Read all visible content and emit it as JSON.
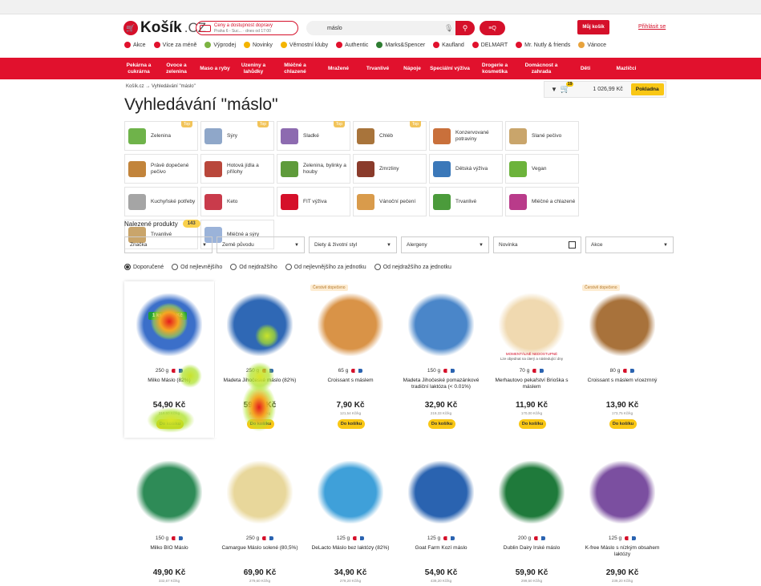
{
  "header": {
    "logo_text": "Košík",
    "logo_tld": ".CZ",
    "delivery_line1": "Ceny a dostupnost dopravy",
    "delivery_line2": "Praha 6 - Suc... · dnes od 17:00",
    "search_value": "máslo",
    "filter_label": "≡Q",
    "cart_label": "Můj košík",
    "login_label": "Přihlásit se"
  },
  "shortcuts": [
    {
      "label": "Akce",
      "color": "#e1112d"
    },
    {
      "label": "Více za méně",
      "color": "#e1112d"
    },
    {
      "label": "Výprodej",
      "color": "#7cb342"
    },
    {
      "label": "Novinky",
      "color": "#f4b400"
    },
    {
      "label": "Věrnostní kluby",
      "color": "#f4b400"
    },
    {
      "label": "Authentic",
      "color": "#e1112d"
    },
    {
      "label": "Marks&Spencer",
      "color": "#2e7d32"
    },
    {
      "label": "Kaufland",
      "color": "#e1112d"
    },
    {
      "label": "DELMART",
      "color": "#e1112d"
    },
    {
      "label": "Mr. Nutly & friends",
      "color": "#e1112d"
    },
    {
      "label": "Vánoce",
      "color": "#e8a33d"
    }
  ],
  "shortcut_marks": {
    "mas": "M&S",
    "delmart": "D"
  },
  "nav": [
    "Pekárna a cukrárna",
    "Ovoce a zelenina",
    "Maso a ryby",
    "Uzeniny a lahůdky",
    "Mléčné a chlazené",
    "Mražené",
    "Trvanlivé",
    "Nápoje",
    "Speciální výživa",
    "Drogerie a kosmetika",
    "Domácnost a zahrada",
    "Děti",
    "Mazlíčci"
  ],
  "breadcrumb": "Košík.cz → Vyhledávání \"máslo\"",
  "cartbar": {
    "badge": "19",
    "sum": "1 026,99 Kč",
    "checkout": "Pokladna"
  },
  "page_title": "Vyhledávání \"máslo\"",
  "categories": [
    {
      "label": "Zelenina",
      "top": true,
      "color": "#6fb34a"
    },
    {
      "label": "Sýry",
      "top": true,
      "color": "#8fa7c9"
    },
    {
      "label": "Sladké",
      "top": true,
      "color": "#8d6bb0"
    },
    {
      "label": "Chléb",
      "top": true,
      "color": "#a8743b"
    },
    {
      "label": "Konzervované potraviny",
      "top": false,
      "color": "#c9703b"
    },
    {
      "label": "Slané pečivo",
      "top": false,
      "color": "#c9a56b"
    },
    {
      "label": "Právě dopečené pečivo",
      "top": false,
      "color": "#c2843b"
    },
    {
      "label": "Hotová jídla a přílohy",
      "top": false,
      "color": "#b9473b"
    },
    {
      "label": "Zelenina, bylinky a houby",
      "top": false,
      "color": "#5f9b3b"
    },
    {
      "label": "Zmrzliny",
      "top": false,
      "color": "#8a3b2b"
    },
    {
      "label": "Dětská výživa",
      "top": false,
      "color": "#3b78b9"
    },
    {
      "label": "Vegan",
      "top": false,
      "color": "#6cb33b"
    },
    {
      "label": "Kuchyňské potřeby",
      "top": false,
      "color": "#a5a5a5"
    },
    {
      "label": "Keto",
      "top": false,
      "color": "#c93b4b"
    },
    {
      "label": "FIT výživa",
      "top": false,
      "color": "#d5102a"
    },
    {
      "label": "Vánoční pečení",
      "top": false,
      "color": "#d99b4b"
    },
    {
      "label": "Trvanlivé",
      "top": false,
      "color": "#4b9b3b"
    },
    {
      "label": "Mléčné a chlazené",
      "top": false,
      "color": "#b93b8a"
    },
    {
      "label": "Trvanlivé",
      "top": false,
      "color": "#c9a56b"
    },
    {
      "label": "Mléčné a sýry",
      "top": false,
      "color": "#9bb3d9"
    }
  ],
  "category_top_label": "Top",
  "found": {
    "label": "Nalezené produkty",
    "count": "143"
  },
  "filters": [
    {
      "label": "Značka",
      "kind": "select"
    },
    {
      "label": "Země původu",
      "kind": "select"
    },
    {
      "label": "Diety & životní styl",
      "kind": "select"
    },
    {
      "label": "Alergeny",
      "kind": "select"
    },
    {
      "label": "Novinka",
      "kind": "checkbox"
    },
    {
      "label": "Akce",
      "kind": "select"
    }
  ],
  "sorts": [
    {
      "label": "Doporučené",
      "selected": true
    },
    {
      "label": "Od nejlevnějšího",
      "selected": false
    },
    {
      "label": "Od nejdražšího",
      "selected": false
    },
    {
      "label": "Od nejlevnějšího za jednotku",
      "selected": false
    },
    {
      "label": "Od nejdražšího za jednotku",
      "selected": false
    }
  ],
  "products": [
    {
      "name": "Milko Máslo (82%)",
      "weight": "250 g",
      "price": "54,90 Kč",
      "unit": "219,60 Kč/kg",
      "fresh": false,
      "badge": "1 ks 54,90 Kč",
      "color": "#3b6fc9",
      "oos": false
    },
    {
      "name": "Madeta Jihočeské máslo (82%)",
      "weight": "250 g",
      "price": "59,90 Kč",
      "unit": "239,60 Kč/kg",
      "fresh": false,
      "badge": "",
      "color": "#2f68b5",
      "oos": false
    },
    {
      "name": "Croissant s máslem",
      "weight": "65 g",
      "price": "7,90 Kč",
      "unit": "121,54 Kč/kg",
      "fresh": true,
      "badge": "",
      "color": "#d99347",
      "oos": false
    },
    {
      "name": "Madeta Jihočeské pomazánkové tradiční laktóza (< 0.01%)",
      "weight": "150 g",
      "price": "32,90 Kč",
      "unit": "219,33 Kč/kg",
      "fresh": false,
      "badge": "",
      "color": "#4a86c9",
      "oos": false
    },
    {
      "name": "Merhautovo pekařství Brioška s máslem",
      "weight": "70 g",
      "price": "11,90 Kč",
      "unit": "170,00 Kč/kg",
      "fresh": false,
      "badge": "",
      "color": "#f0d9b0",
      "oos": true
    },
    {
      "name": "Croissant s máslem vícezrnný",
      "weight": "80 g",
      "price": "13,90 Kč",
      "unit": "173,75 Kč/kg",
      "fresh": true,
      "badge": "",
      "color": "#a8723b",
      "oos": false
    },
    {
      "name": "Milko BIO Máslo",
      "weight": "150 g",
      "price": "49,90 Kč",
      "unit": "332,67 Kč/kg",
      "fresh": false,
      "badge": "",
      "color": "#2e8b57",
      "oos": false
    },
    {
      "name": "Camargue Máslo solené (80,5%)",
      "weight": "250 g",
      "price": "69,90 Kč",
      "unit": "279,60 Kč/kg",
      "fresh": false,
      "badge": "",
      "color": "#e8d79b",
      "oos": false
    },
    {
      "name": "DeLacto Máslo bez laktózy (82%)",
      "weight": "125 g",
      "price": "34,90 Kč",
      "unit": "279,20 Kč/kg",
      "fresh": false,
      "badge": "",
      "color": "#3fa0d9",
      "oos": false
    },
    {
      "name": "Goat Farm Kozí máslo",
      "weight": "125 g",
      "price": "54,90 Kč",
      "unit": "439,20 Kč/kg",
      "fresh": false,
      "badge": "",
      "color": "#2a63b0",
      "oos": false
    },
    {
      "name": "Dublin Dairy Irské máslo",
      "weight": "200 g",
      "price": "59,90 Kč",
      "unit": "299,50 Kč/kg",
      "fresh": false,
      "badge": "",
      "color": "#1f7a3b",
      "oos": false
    },
    {
      "name": "K-free Máslo s nízkým obsahem laktózy",
      "weight": "125 g",
      "price": "29,90 Kč",
      "unit": "239,20 Kč/kg",
      "fresh": false,
      "badge": "",
      "color": "#7b4fa0",
      "oos": false
    }
  ],
  "labels": {
    "fresh": "Čerstvě dopečeno",
    "buy": "Do košíku",
    "oos_line1": "MOMENTÁLNĚ NEDOSTUPNÉ",
    "oos_line2": "Lze objednat na úterý a následující dny"
  }
}
